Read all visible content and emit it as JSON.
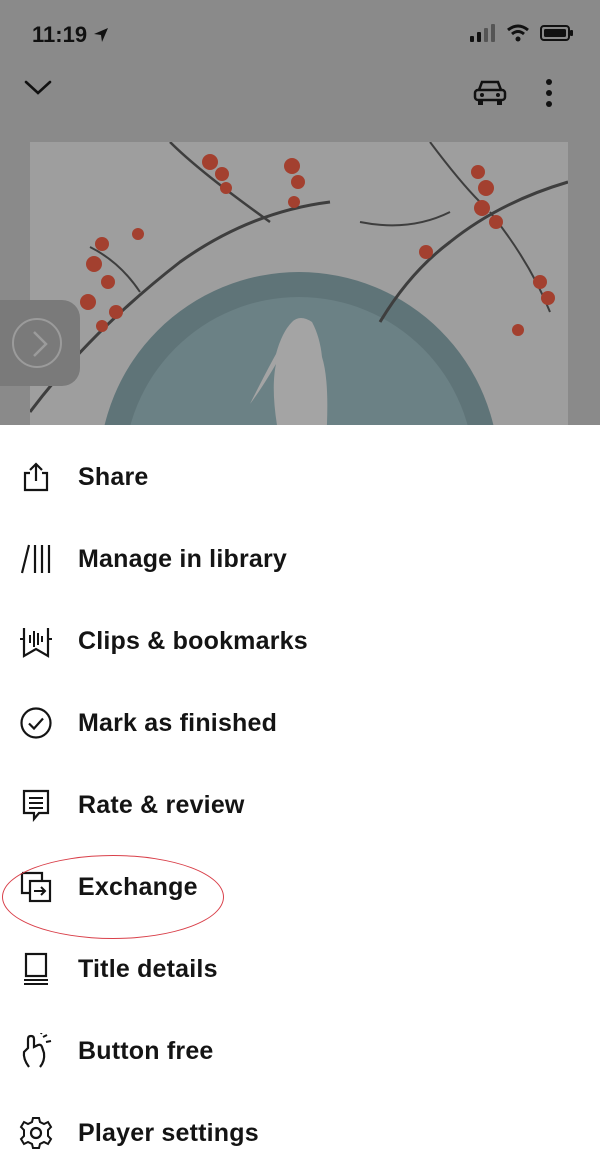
{
  "status_bar": {
    "time": "11:19"
  },
  "top_bar": {
    "collapse_icon": "chevron-down-icon",
    "car_mode_icon": "car-icon",
    "more_icon": "more-vertical-icon"
  },
  "menu": {
    "items": [
      {
        "label": "Share",
        "icon": "share-icon"
      },
      {
        "label": "Manage in library",
        "icon": "library-icon"
      },
      {
        "label": "Clips & bookmarks",
        "icon": "bookmark-icon"
      },
      {
        "label": "Mark as finished",
        "icon": "check-circle-icon"
      },
      {
        "label": "Rate & review",
        "icon": "review-icon"
      },
      {
        "label": "Exchange",
        "icon": "exchange-icon"
      },
      {
        "label": "Title details",
        "icon": "book-icon"
      },
      {
        "label": "Button free",
        "icon": "gesture-icon"
      },
      {
        "label": "Player settings",
        "icon": "gear-icon"
      }
    ]
  },
  "colors": {
    "overlay": "#8a8a8a",
    "highlight": "#d9404a",
    "text": "#141414"
  }
}
